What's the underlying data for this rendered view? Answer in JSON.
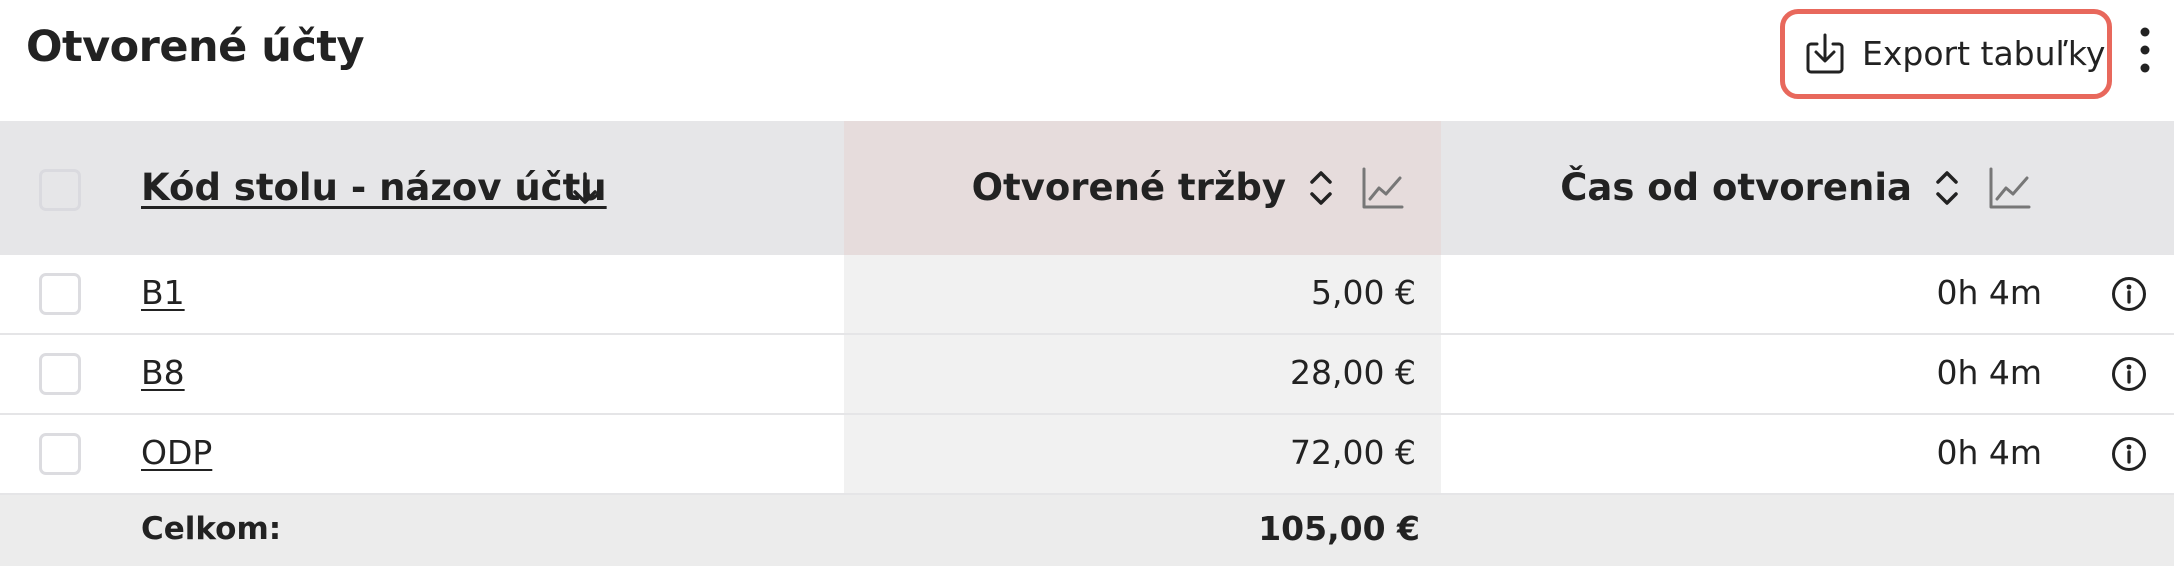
{
  "header": {
    "title": "Otvorené účty",
    "export_label": "Export tabuľky",
    "export_icon": "download-icon",
    "more_icon": "more-vertical-icon"
  },
  "table": {
    "columns": {
      "name": "Kód stolu - názov účtu",
      "revenue": "Otvorené tržby",
      "time": "Čas od otvorenia"
    },
    "rows": [
      {
        "name": "B1",
        "revenue": "5,00 €",
        "time": "0h 4m"
      },
      {
        "name": "B8",
        "revenue": "28,00 €",
        "time": "0h 4m"
      },
      {
        "name": "ODP",
        "revenue": "72,00 €",
        "time": "0h 4m"
      }
    ],
    "footer": {
      "label": "Celkom:",
      "total": "105,00 €"
    }
  },
  "colors": {
    "accent_border": "#e8685c",
    "header_bg": "#e6e6e8",
    "highlight_column_header": "#e6dcdc",
    "highlight_column_cells": "#f1f1f1",
    "footer_bg": "#ececec"
  }
}
